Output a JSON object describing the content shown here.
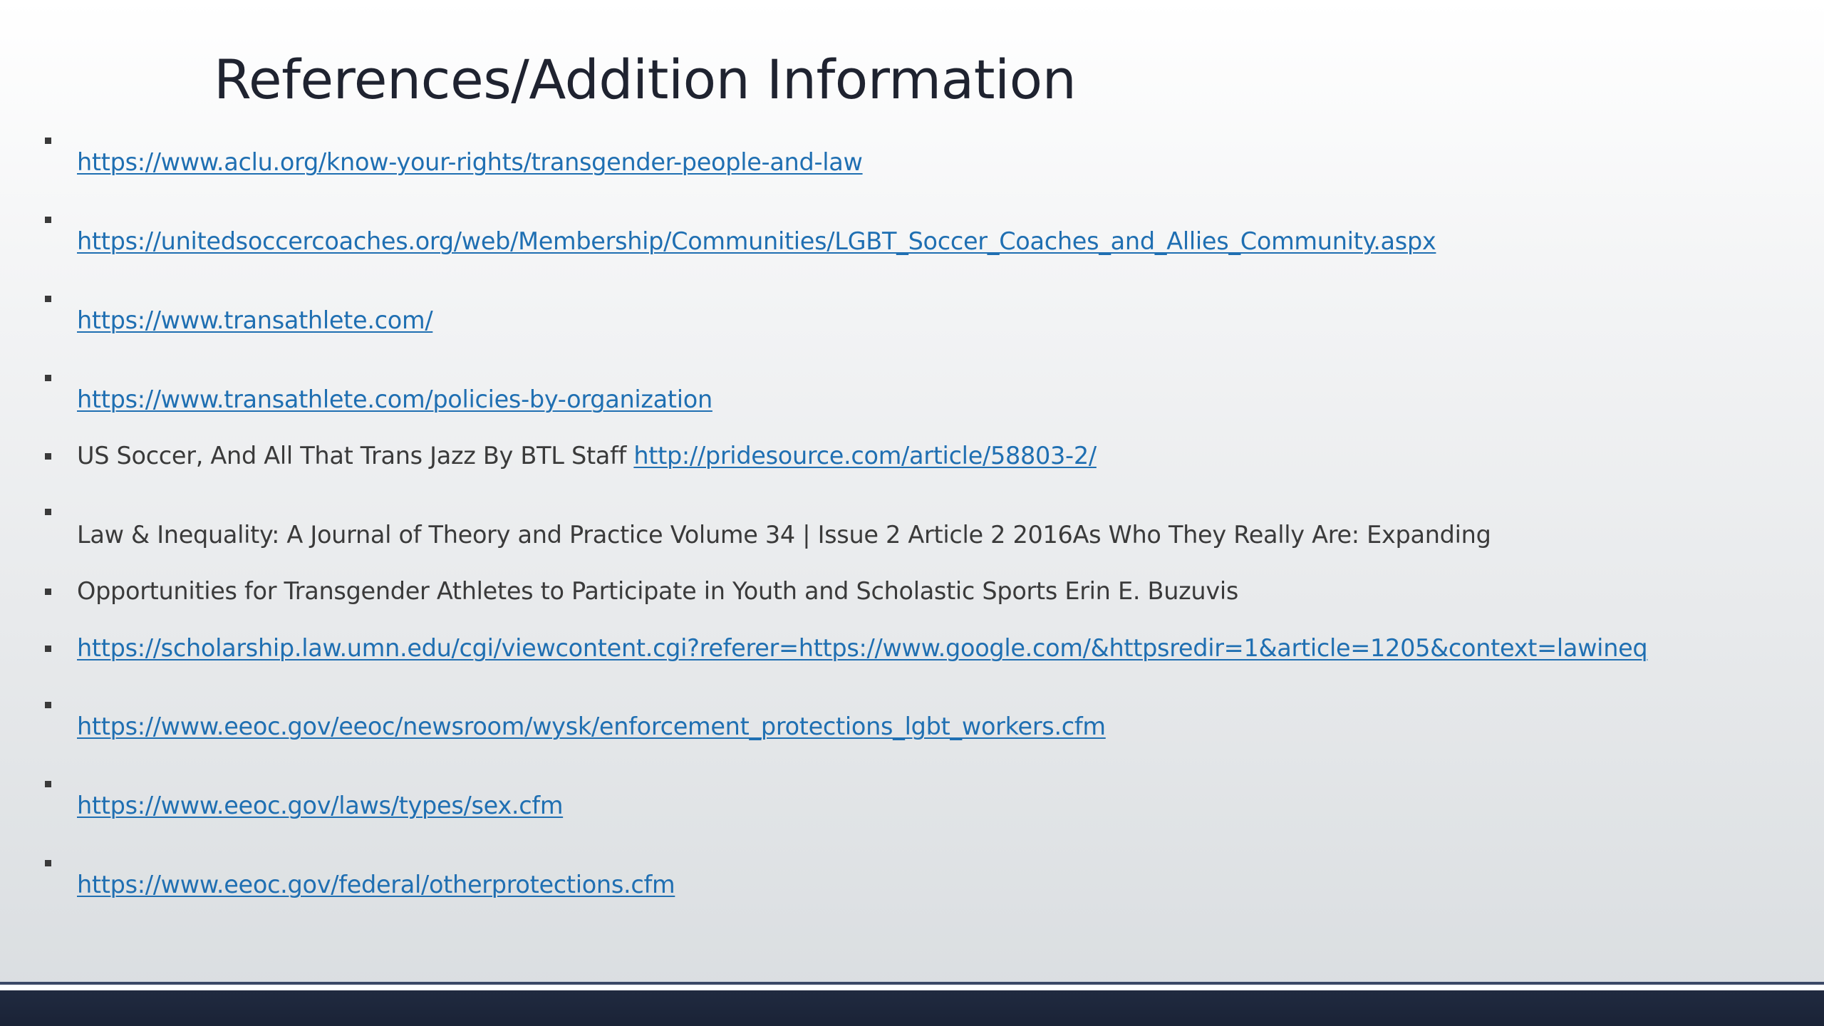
{
  "slide": {
    "title": "References/Addition Information",
    "items": [
      {
        "type": "link",
        "link": "https://www.aclu.org/know-your-rights/transgender-people-and-law"
      },
      {
        "type": "link",
        "link": "https://unitedsoccercoaches.org/web/Membership/Communities/LGBT_Soccer_Coaches_and_Allies_Community.aspx"
      },
      {
        "type": "link",
        "link": "https://www.transathlete.com/"
      },
      {
        "type": "link",
        "link": "https://www.transathlete.com/policies-by-organization"
      },
      {
        "type": "mixed",
        "text": "US Soccer, And All That Trans Jazz By BTL Staff ",
        "link": "http://pridesource.com/article/58803-2/"
      },
      {
        "type": "text",
        "text": "Law & Inequality: A Journal of Theory and Practice Volume 34 | Issue 2 Article 2 2016As Who They Really Are: Expanding"
      },
      {
        "type": "text",
        "text": "Opportunities for Transgender Athletes to Participate in Youth and Scholastic Sports Erin E. Buzuvis"
      },
      {
        "type": "link",
        "link": "https://scholarship.law.umn.edu/cgi/viewcontent.cgi?referer=https://www.google.com/&httpsredir=1&article=1205&context=lawineq"
      },
      {
        "type": "link",
        "link": "https://www.eeoc.gov/eeoc/newsroom/wysk/enforcement_protections_lgbt_workers.cfm"
      },
      {
        "type": "link",
        "link": "https://www.eeoc.gov/laws/types/sex.cfm"
      },
      {
        "type": "link",
        "link": "https://www.eeoc.gov/federal/otherprotections.cfm"
      }
    ]
  },
  "colors": {
    "link": "#1f6fb2",
    "text": "#3a3a3a",
    "title": "#1f2330",
    "footer": "#1a2336"
  }
}
